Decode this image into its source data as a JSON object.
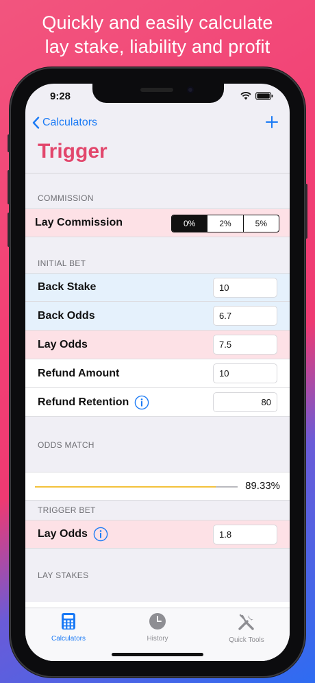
{
  "headline": {
    "line1": "Quickly and easily calculate",
    "line2": "lay stake, liability and profit"
  },
  "status_bar": {
    "time": "9:28"
  },
  "nav": {
    "back_label": "Calculators",
    "add_icon": "plus-icon"
  },
  "page_title": "Trigger",
  "commission": {
    "header": "COMMISSION",
    "label": "Lay Commission",
    "options": [
      "0%",
      "2%",
      "5%"
    ],
    "selected": "0%"
  },
  "initial_bet": {
    "header": "INITIAL BET",
    "rows": [
      {
        "label": "Back Stake",
        "value": "10"
      },
      {
        "label": "Back Odds",
        "value": "6.7"
      },
      {
        "label": "Lay Odds",
        "value": "7.5"
      },
      {
        "label": "Refund Amount",
        "value": "10"
      },
      {
        "label": "Refund Retention",
        "value": "80"
      }
    ]
  },
  "odds_match": {
    "header": "ODDS MATCH",
    "value": "89.33%",
    "fraction": 0.8933
  },
  "trigger_bet": {
    "header": "TRIGGER BET",
    "label": "Lay Odds",
    "value": "1.8"
  },
  "lay_stakes": {
    "header": "LAY STAKES"
  },
  "tabs": [
    {
      "label": "Calculators",
      "icon": "calculator-icon",
      "active": true
    },
    {
      "label": "History",
      "icon": "clock-icon",
      "active": false
    },
    {
      "label": "Quick Tools",
      "icon": "tools-icon",
      "active": false
    }
  ],
  "colors": {
    "accent": "#1a7af5",
    "title": "#e2476c",
    "pink_row": "#fde1e6",
    "blue_row": "#e5f1fc",
    "match_bar": "#f3c13a"
  }
}
